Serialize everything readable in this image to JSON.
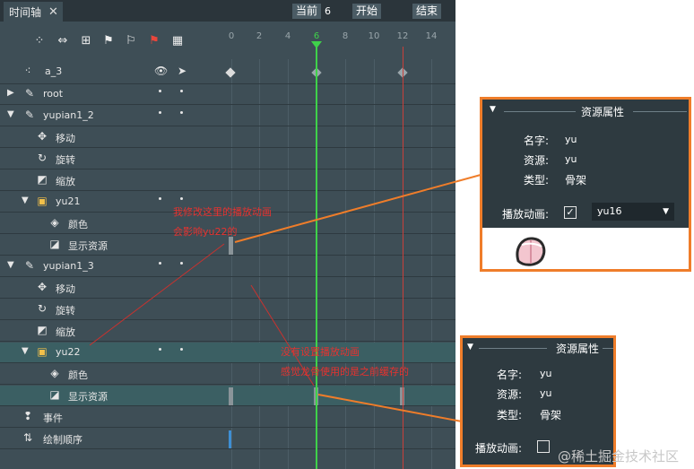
{
  "tab": {
    "title": "时间轴",
    "close": "✕"
  },
  "controls": {
    "current_label": "当前",
    "current_value": "6",
    "start_label": "开始",
    "end_label": "结束"
  },
  "toolbar": {
    "tools": [
      "scatter-icon",
      "double-arrow-icon",
      "tree-icon",
      "flag-left-icon",
      "flag-right-icon",
      "flag-red-icon",
      "grid-icon"
    ]
  },
  "ruler": {
    "ticks": [
      "0",
      "2",
      "4",
      "6",
      "8",
      "10",
      "12",
      "14"
    ],
    "current": "6"
  },
  "rows": [
    {
      "label": "a_3",
      "icon": "bone-dots-icon",
      "eye": "👁",
      "cursor": "➤",
      "indent": 22
    },
    {
      "label": "root",
      "icon": "brush-icon",
      "arrow": "▶",
      "indent": 28
    },
    {
      "label": "yupian1_2",
      "icon": "brush-icon",
      "arrow": "▼",
      "indent": 28
    },
    {
      "label": "移动",
      "icon": "move-icon",
      "indent": 64
    },
    {
      "label": "旋转",
      "icon": "rotate-icon",
      "indent": 64
    },
    {
      "label": "缩放",
      "icon": "scale-icon",
      "indent": 64
    },
    {
      "label": "yu21",
      "icon": "image-icon",
      "arrow": "▼",
      "indent": 62
    },
    {
      "label": "颜色",
      "icon": "paint-bucket-icon",
      "indent": 76
    },
    {
      "label": "显示资源",
      "icon": "display-resource-icon",
      "indent": 76
    },
    {
      "label": "yupian1_3",
      "icon": "brush-icon",
      "arrow": "▼",
      "indent": 28
    },
    {
      "label": "移动",
      "icon": "move-icon",
      "indent": 64
    },
    {
      "label": "旋转",
      "icon": "rotate-icon",
      "indent": 64
    },
    {
      "label": "缩放",
      "icon": "scale-icon",
      "indent": 64
    },
    {
      "label": "yu22",
      "icon": "image-icon",
      "arrow": "▼",
      "indent": 62
    },
    {
      "label": "颜色",
      "icon": "paint-bucket-icon",
      "indent": 76
    },
    {
      "label": "显示资源",
      "icon": "display-resource-icon",
      "indent": 76
    },
    {
      "label": "事件",
      "icon": "event-icon",
      "indent": 48
    },
    {
      "label": "绘制顺序",
      "icon": "draw-order-icon",
      "indent": 48
    }
  ],
  "panel_top": {
    "title": "资源属性",
    "name_label": "名字:",
    "name_value": "yu",
    "resource_label": "资源:",
    "resource_value": "yu",
    "type_label": "类型:",
    "type_value": "骨架",
    "anim_label": "播放动画:",
    "anim_checked": "✓",
    "anim_select": "yu16",
    "select_arrow": "▼"
  },
  "panel_bottom": {
    "title": "资源属性",
    "name_label": "名字:",
    "name_value": "yu",
    "resource_label": "资源:",
    "resource_value": "yu",
    "type_label": "类型:",
    "type_value": "骨架",
    "anim_label": "播放动画:"
  },
  "annotations": {
    "a1_line1": "我修改这里的播放动画",
    "a1_line2": "会影响yu22的",
    "a2_line1": "没有设置播放动画",
    "a2_line2": "感觉龙骨使用的是之前缓存的"
  },
  "watermark": "@稀土掘金技术社区",
  "colors": {
    "cursor": "#3fd24a",
    "end_line": "#c8403a",
    "highlight": "#ef7d2a",
    "annotation": "#e8322f",
    "panel_bg": "#2e3a40",
    "timeline_bg": "#3e4e56"
  }
}
